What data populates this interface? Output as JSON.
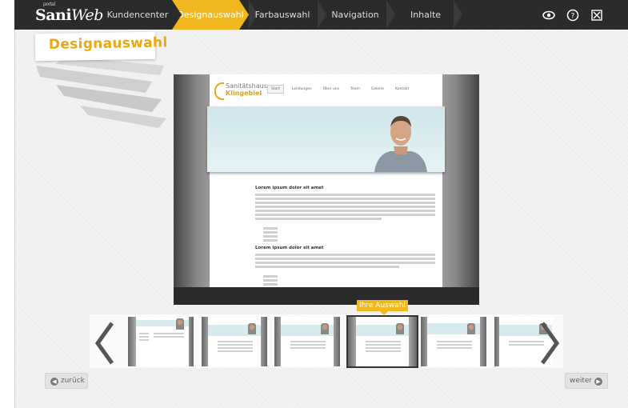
{
  "app": {
    "logo_main": "Sani",
    "logo_script": "Web",
    "logo_sup": "portal"
  },
  "nav": {
    "items": [
      {
        "label": "Kundencenter",
        "active": false
      },
      {
        "label": "Designauswahl",
        "active": true
      },
      {
        "label": "Farbauswahl",
        "active": false
      },
      {
        "label": "Navigation",
        "active": false
      },
      {
        "label": "Inhalte",
        "active": false
      }
    ],
    "icons": [
      "eye-icon",
      "help-icon",
      "close-icon"
    ]
  },
  "page": {
    "title": "Designauswahl"
  },
  "preview": {
    "site_logo_line1": "Sanitätshaus",
    "site_logo_line2": "Klingebiel",
    "site_nav": [
      "Start",
      "Leistungen",
      "Über uns",
      "Team",
      "Galerie",
      "Kontakt"
    ],
    "heading1": "Lorem ipsum dolor sit amet",
    "heading2": "Lorem ipsum dolor sit amet"
  },
  "carousel": {
    "selected_label": "Ihre Auswahl",
    "selected_index": 3
  },
  "buttons": {
    "back": "zurück",
    "next": "weiter"
  },
  "colors": {
    "accent": "#f0b81e",
    "topbar": "#2b2b2b"
  }
}
